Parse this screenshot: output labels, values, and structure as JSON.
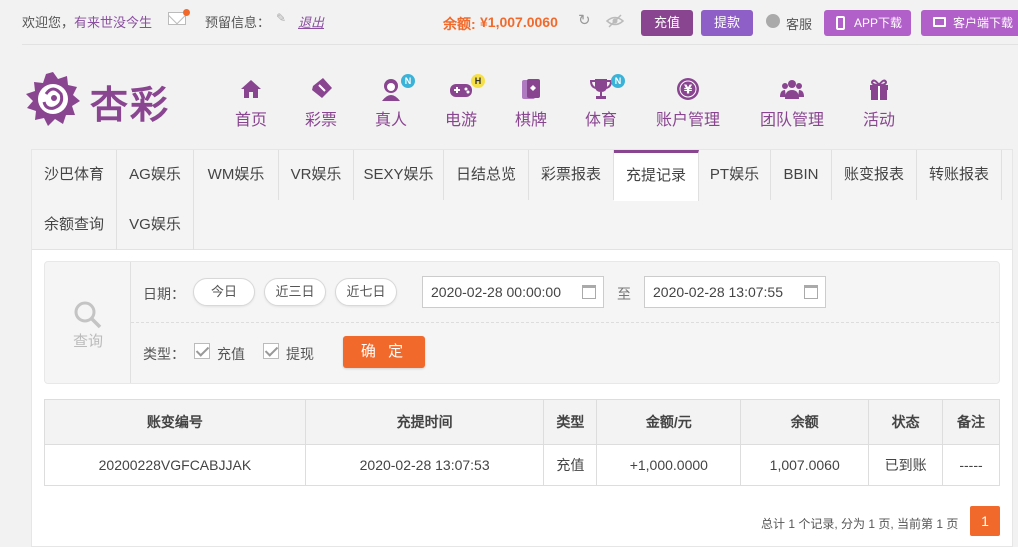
{
  "topbar": {
    "welcome": "欢迎您，",
    "username": "有来世没今生",
    "reserve_label": "预留信息：",
    "logout": "退出",
    "balance_label": "余额:",
    "balance": "¥1,007.0060",
    "deposit": "充值",
    "withdraw": "提款",
    "customer_service": "客服",
    "app_download": "APP下载",
    "client_download": "客户端下载"
  },
  "logo": {
    "text": "杏彩"
  },
  "nav": [
    {
      "label": "首页",
      "icon": "home-icon"
    },
    {
      "label": "彩票",
      "icon": "ticket-icon"
    },
    {
      "label": "真人",
      "icon": "live-dealer-icon",
      "badge": "N"
    },
    {
      "label": "电游",
      "icon": "gamepad-icon",
      "badge": "H"
    },
    {
      "label": "棋牌",
      "icon": "cards-icon"
    },
    {
      "label": "体育",
      "icon": "trophy-icon",
      "badge": "N"
    },
    {
      "label": "账户管理",
      "icon": "yen-coin-icon"
    },
    {
      "label": "团队管理",
      "icon": "team-icon"
    },
    {
      "label": "活动",
      "icon": "gift-icon"
    }
  ],
  "tabs": [
    "沙巴体育",
    "AG娱乐",
    "WM娱乐",
    "VR娱乐",
    "SEXY娱乐",
    "日结总览",
    "彩票报表",
    "充提记录",
    "PT娱乐",
    "BBIN",
    "账变报表",
    "转账报表",
    "余额查询",
    "VG娱乐"
  ],
  "active_tab": "充提记录",
  "filter": {
    "query_label": "查询",
    "date_label": "日期：",
    "quick_dates": [
      "今日",
      "近三日",
      "近七日"
    ],
    "date_from": "2020-02-28 00:00:00",
    "to_label": "至",
    "date_to": "2020-02-28 13:07:55",
    "type_label": "类型：",
    "types": [
      {
        "label": "充值",
        "checked": true
      },
      {
        "label": "提现",
        "checked": true
      }
    ],
    "confirm": "确 定"
  },
  "table": {
    "headers": [
      "账变编号",
      "充提时间",
      "类型",
      "金额/元",
      "余额",
      "状态",
      "备注"
    ],
    "rows": [
      [
        "20200228VGFCABJJAK",
        "2020-02-28 13:07:53",
        "充值",
        "+1,000.0000",
        "1,007.0060",
        "已到账",
        "-----"
      ]
    ]
  },
  "pager": {
    "summary": "总计 1 个记录, 分为 1 页, 当前第 1 页",
    "current_page": "1"
  },
  "colors": {
    "brand": "#8a4591",
    "accent": "#f26a2b",
    "success": "#3a9a1a",
    "amount": "#e03a3a"
  }
}
